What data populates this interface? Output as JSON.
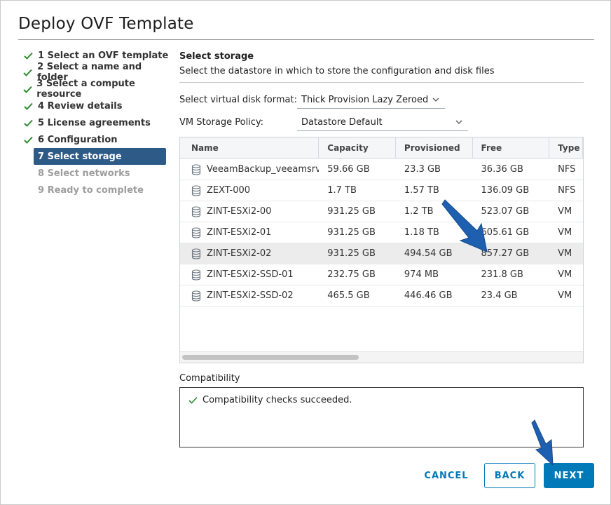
{
  "dialog": {
    "title": "Deploy OVF Template"
  },
  "steps": [
    {
      "label": "1 Select an OVF template",
      "state": "done"
    },
    {
      "label": "2 Select a name and folder",
      "state": "done"
    },
    {
      "label": "3 Select a compute resource",
      "state": "done"
    },
    {
      "label": "4 Review details",
      "state": "done"
    },
    {
      "label": "5 License agreements",
      "state": "done"
    },
    {
      "label": "6 Configuration",
      "state": "done"
    },
    {
      "label": "7 Select storage",
      "state": "active"
    },
    {
      "label": "8 Select networks",
      "state": "disabled"
    },
    {
      "label": "9 Ready to complete",
      "state": "disabled"
    }
  ],
  "storage": {
    "heading": "Select storage",
    "subheading": "Select the datastore in which to store the configuration and disk files",
    "disk_format_label": "Select virtual disk format:",
    "disk_format_value": "Thick Provision Lazy Zeroed",
    "policy_label": "VM Storage Policy:",
    "policy_value": "Datastore Default"
  },
  "table": {
    "columns": [
      "Name",
      "Capacity",
      "Provisioned",
      "Free",
      "Type"
    ],
    "rows": [
      {
        "name": "VeeamBackup_veeamsrv",
        "capacity": "59.66 GB",
        "provisioned": "23.3 GB",
        "free": "36.36 GB",
        "type": "NFS",
        "selected": false
      },
      {
        "name": "ZEXT-000",
        "capacity": "1.7 TB",
        "provisioned": "1.57 TB",
        "free": "136.09 GB",
        "type": "NFS",
        "selected": false
      },
      {
        "name": "ZINT-ESXi2-00",
        "capacity": "931.25 GB",
        "provisioned": "1.2 TB",
        "free": "523.07 GB",
        "type": "VM",
        "selected": false
      },
      {
        "name": "ZINT-ESXi2-01",
        "capacity": "931.25 GB",
        "provisioned": "1.18 TB",
        "free": "605.61 GB",
        "type": "VM",
        "selected": false
      },
      {
        "name": "ZINT-ESXi2-02",
        "capacity": "931.25 GB",
        "provisioned": "494.54 GB",
        "free": "857.27 GB",
        "type": "VM",
        "selected": true
      },
      {
        "name": "ZINT-ESXi2-SSD-01",
        "capacity": "232.75 GB",
        "provisioned": "974 MB",
        "free": "231.8 GB",
        "type": "VM",
        "selected": false
      },
      {
        "name": "ZINT-ESXi2-SSD-02",
        "capacity": "465.5 GB",
        "provisioned": "446.46 GB",
        "free": "23.4 GB",
        "type": "VM",
        "selected": false
      }
    ]
  },
  "compatibility": {
    "label": "Compatibility",
    "message": "Compatibility checks succeeded."
  },
  "buttons": {
    "cancel": "CANCEL",
    "back": "BACK",
    "next": "NEXT"
  },
  "colors": {
    "accent": "#0079b8",
    "active_step": "#2e5a87",
    "check": "#2e8b2e",
    "annotation_arrow": "#1f5fb0"
  }
}
